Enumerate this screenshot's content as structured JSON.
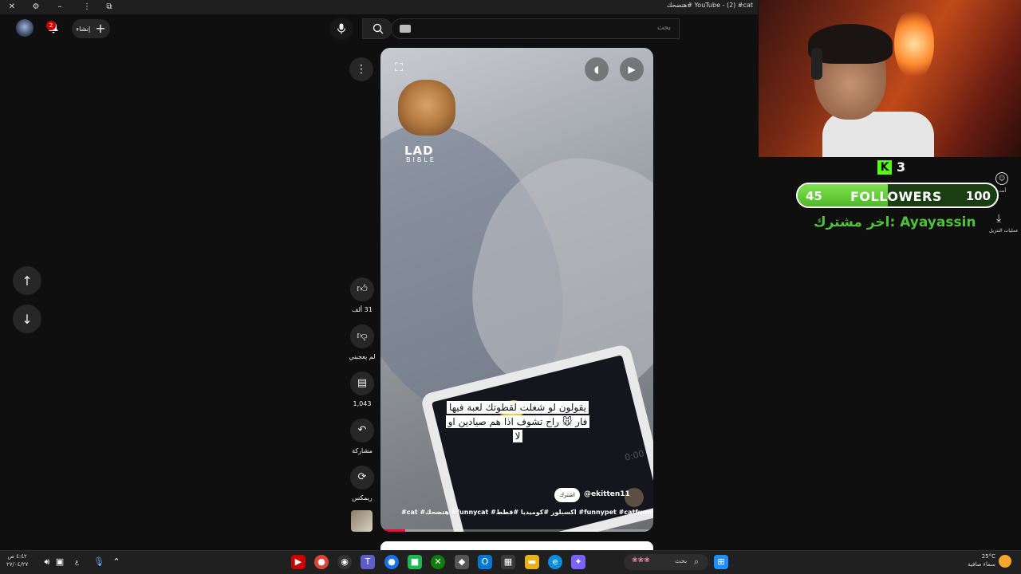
{
  "window": {
    "title": "YouTube - (2) #cat #هتضحك"
  },
  "header": {
    "search_placeholder": "بحث",
    "create_label": "إنشاء",
    "notification_count": "2"
  },
  "short": {
    "watermark": "LAD",
    "watermark_sub": "BIBLE",
    "caption": "يقولون لو شغلت لقطوتك لعبة فيها فار 🐭 راح تشوف اذا هم صيادين او لا",
    "tablet_timer": "0:00",
    "channel": "@ekitten11",
    "subscribe_label": "اشترك",
    "hashtags": "#cat #هتضحك #funnycat #اكسبلور #كوميديا #قطط #funnypet #catfunny #funny",
    "progress_fraction": 0.09
  },
  "actions": {
    "likes": "31 ألف",
    "dislike_label": "لم يعجبني",
    "comments": "1,043",
    "share_label": "مشاركة",
    "remix_label": "ريمكس"
  },
  "overlay": {
    "kick_count": "3",
    "followers_current": "45",
    "followers_label": "FOLLOWERS",
    "followers_goal": "100",
    "last_subscriber": "اخر مشترك: Ayayassin",
    "side_label_1": "أنت",
    "side_label_2": "عمليات التنزيل"
  },
  "taskbar": {
    "search_text": "بحث",
    "time": "٤:٤٢ ص",
    "date": "٢٧/٠٤/٢٧",
    "weather_temp": "25°C",
    "weather_desc": "سماء صافية",
    "lang": "ع"
  },
  "colors": {
    "youtube_red": "#ff0033",
    "kick_green": "#53fc18",
    "last_sub_green": "#4fc23a"
  }
}
